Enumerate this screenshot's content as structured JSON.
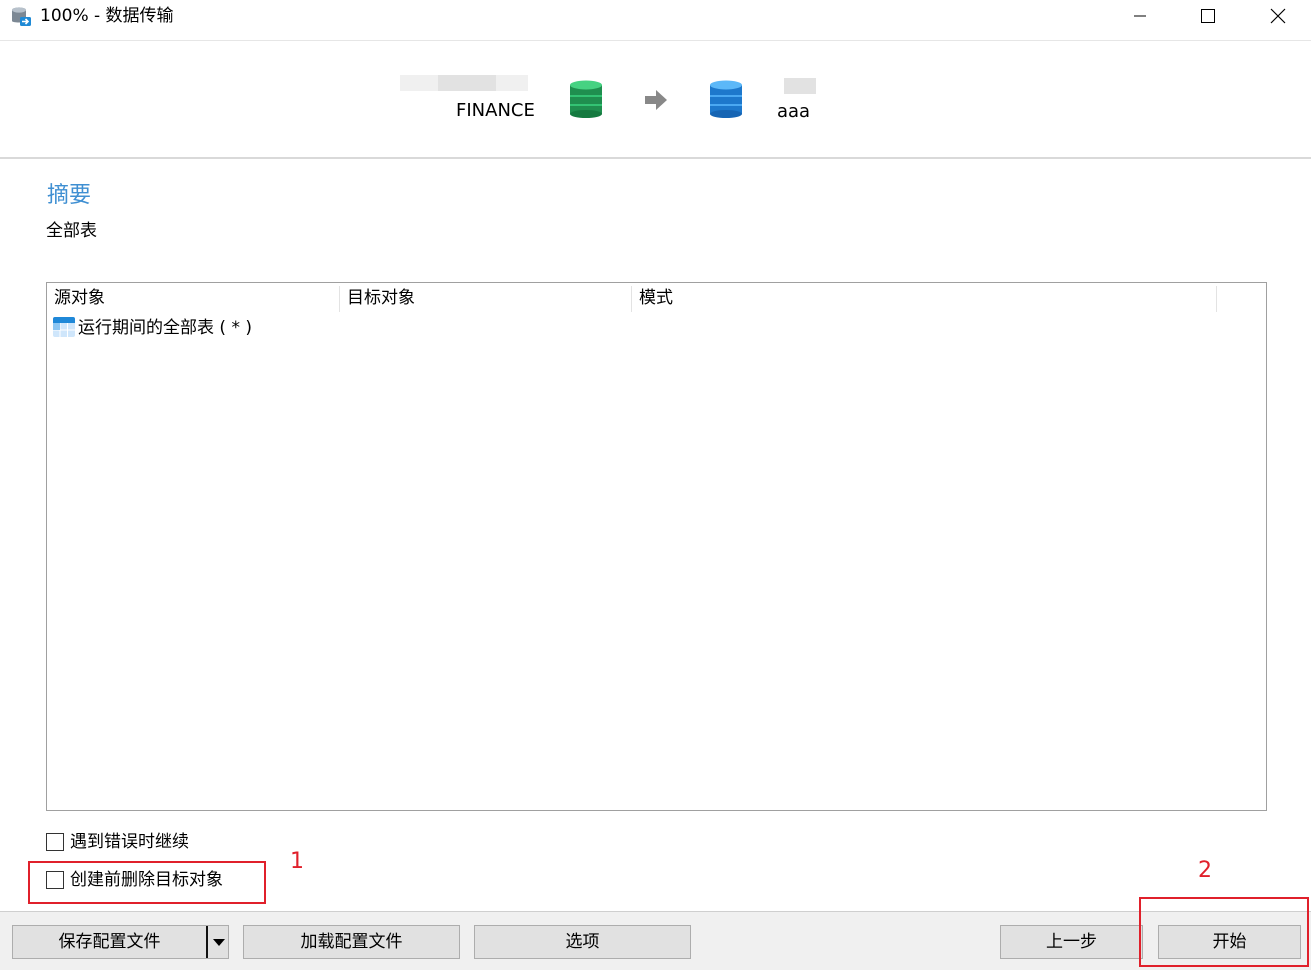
{
  "window": {
    "title": "100% - 数据传输",
    "icons": {
      "app": "database-transfer-icon",
      "minimize": "minimize-icon",
      "maximize": "maximize-icon",
      "close": "close-icon"
    }
  },
  "connection": {
    "source_name": "FINANCE",
    "target_name": "aaa",
    "icons": {
      "source": "source-database-icon",
      "arrow": "arrow-right-icon",
      "target": "target-database-icon"
    },
    "colors": {
      "source_db": "#2eaf63",
      "target_db": "#2f8fe0"
    }
  },
  "summary": {
    "title": "摘要",
    "subtitle": "全部表",
    "title_color": "#3f8fd2"
  },
  "table": {
    "columns": [
      "源对象",
      "目标对象",
      "模式"
    ],
    "rows": [
      {
        "icon": "table-icon",
        "source": "运行期间的全部表 ( * )"
      }
    ]
  },
  "options": {
    "continue_on_error": {
      "label": "遇到错误时继续",
      "checked": false
    },
    "drop_before_create": {
      "label": "创建前删除目标对象",
      "checked": false
    }
  },
  "annotations": {
    "marker1": "1",
    "marker2": "2",
    "color": "#e0202b"
  },
  "footer": {
    "save_profile": "保存配置文件",
    "load_profile": "加载配置文件",
    "options": "选项",
    "back": "上一步",
    "start": "开始"
  }
}
